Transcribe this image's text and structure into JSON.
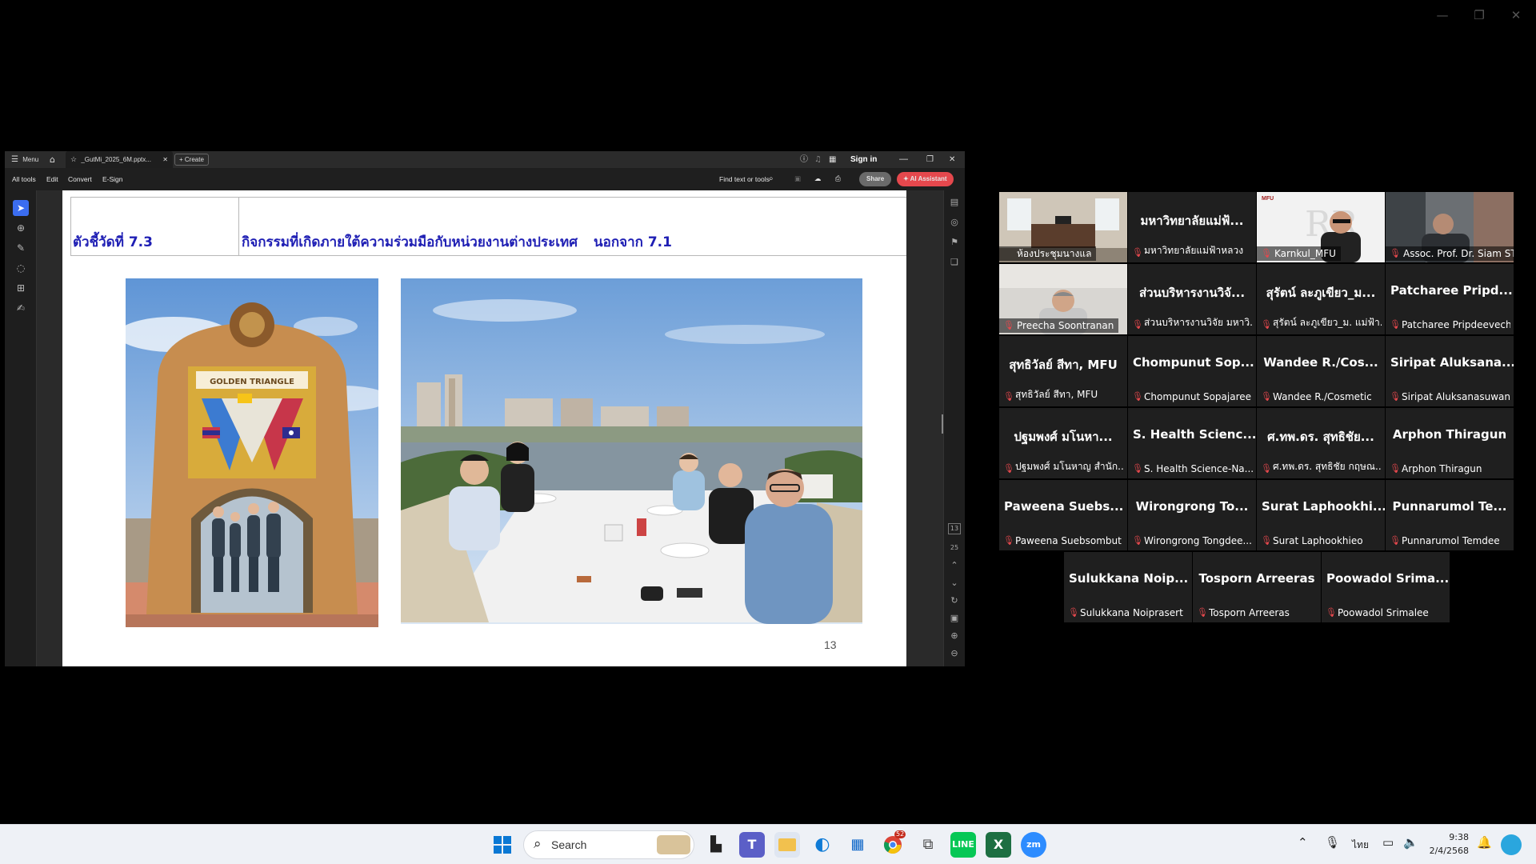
{
  "acrobat": {
    "menu_label": "Menu",
    "tab_title": "_GutMi_2025_6M.pptx...",
    "create_label": "Create",
    "sign_in": "Sign in",
    "menus": [
      "All tools",
      "Edit",
      "Convert",
      "E-Sign"
    ],
    "find_placeholder": "Find text or tools",
    "share_label": "Share",
    "ai_label": "AI Assistant",
    "page_current": "13",
    "page_total": "25"
  },
  "slide": {
    "indicator_label": "ตัวชี้วัดที่ 7.3",
    "activity_text": "กิจกรรมที่เกิดภายใต้ความร่วมมือกับหน่วยงานต่างประเทศ",
    "except_text": "นอกจาก 7.1",
    "photo1_sign": "GOLDEN TRIANGLE",
    "page_number": "13"
  },
  "zoom": {
    "tiles": [
      {
        "big": "",
        "name": "ห้องประชุมนางแล",
        "video": true
      },
      {
        "big": "มหาวิทยาลัยแม่ฟ้...",
        "name": "มหาวิทยาลัยแม่ฟ้าหลวง",
        "video": false
      },
      {
        "big": "",
        "name": "Karnkul_MFU",
        "video": true,
        "logo": "MFU"
      },
      {
        "big": "",
        "name": "Assoc. Prof. Dr. Siam STI...",
        "video": true,
        "active": true
      },
      {
        "big": "",
        "name": "Preecha Soontranan",
        "video": true
      },
      {
        "big": "ส่วนบริหารงานวิจั...",
        "name": "ส่วนบริหารงานวิจัย มหาวิ...",
        "video": false
      },
      {
        "big": "สุรัตน์ ละภูเขียว_ม...",
        "name": "สุรัตน์ ละภูเขียว_ม. แม่ฟ้า...",
        "video": false
      },
      {
        "big": "Patcharee Pripd...",
        "name": "Patcharee Pripdeevech",
        "video": false
      },
      {
        "big": "สุทธิวัลย์ สีทา, MFU",
        "name": "สุทธิวัลย์ สีทา, MFU",
        "video": false
      },
      {
        "big": "Chompunut Sop...",
        "name": "Chompunut Sopajaree",
        "video": false
      },
      {
        "big": "Wandee R./Cos...",
        "name": "Wandee R./Cosmetic",
        "video": false
      },
      {
        "big": "Siripat Aluksana...",
        "name": "Siripat Aluksanasuwan",
        "video": false
      },
      {
        "big": "ปฐมพงศ์ มโนหา...",
        "name": "ปฐมพงศ์ มโนหาญ สำนัก...",
        "video": false
      },
      {
        "big": "S. Health Scienc...",
        "name": "S. Health Science-Na...",
        "video": false
      },
      {
        "big": "ศ.ทพ.ดร. สุทธิชัย...",
        "name": "ศ.ทพ.ดร. สุทธิชัย กฤษณ...",
        "video": false
      },
      {
        "big": "Arphon Thiragun",
        "name": "Arphon Thiragun",
        "video": false
      },
      {
        "big": "Paweena Suebs...",
        "name": "Paweena Suebsombut",
        "video": false
      },
      {
        "big": "Wirongrong To...",
        "name": "Wirongrong Tongdee...",
        "video": false
      },
      {
        "big": "Surat Laphookhi...",
        "name": "Surat Laphookhieo",
        "video": false
      },
      {
        "big": "Punnarumol Te...",
        "name": "Punnarumol Temdee",
        "video": false
      },
      {
        "big": "Sulukkana Noip...",
        "name": "Sulukkana Noiprasert",
        "video": false
      },
      {
        "big": "Tosporn Arreeras",
        "name": "Tosporn Arreeras",
        "video": false
      },
      {
        "big": "Poowadol Srima...",
        "name": "Poowadol Srimalee",
        "video": false
      }
    ]
  },
  "taskbar": {
    "search_label": "Search",
    "lang": "ไทย",
    "time": "9:38",
    "date": "2/4/2568",
    "chrome_badge": "52"
  },
  "colors": {
    "slide_title": "#1f1fb4",
    "share_bg": "#6a6a6a",
    "ai_bg": "#e5484d",
    "active_speaker": "#23d18b",
    "mic_muted": "#e5484d"
  }
}
